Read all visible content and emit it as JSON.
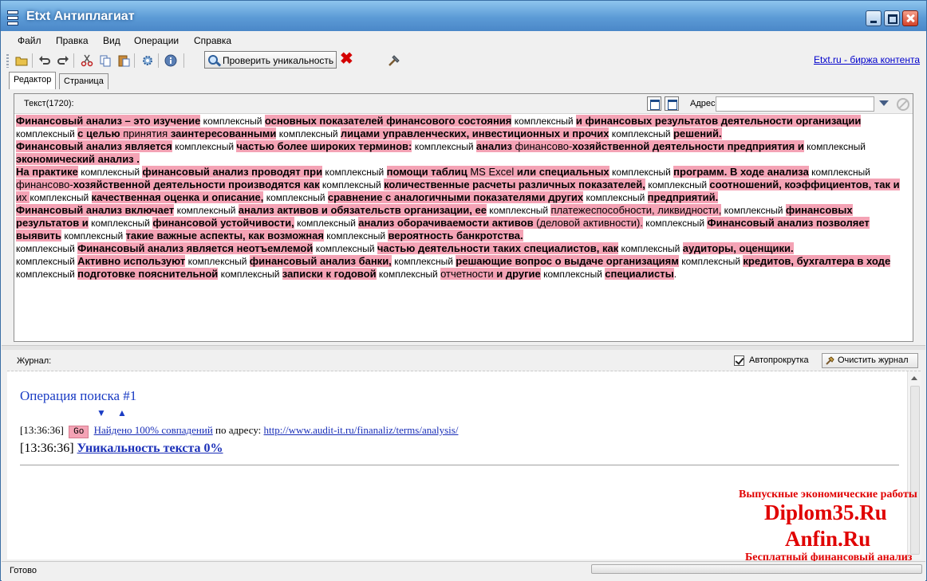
{
  "window": {
    "title": "Etxt Антиплагиат"
  },
  "menu": [
    "Файл",
    "Правка",
    "Вид",
    "Операции",
    "Справка"
  ],
  "toolbar": {
    "check_label": "Проверить уникальность",
    "top_link": "Etxt.ru - биржа контента",
    "icons": [
      "open-icon",
      "undo-icon",
      "redo-icon",
      "cut-icon",
      "copy-icon",
      "paste-icon",
      "settings-icon",
      "info-icon",
      "stop-icon",
      "tools-icon"
    ]
  },
  "tabs": [
    "Редактор",
    "Страница"
  ],
  "editor": {
    "count_label": "Текст(1720):",
    "address_label": "Адрес:",
    "address_value": ""
  },
  "journal": {
    "label": "Журнал:",
    "autoscroll_label": "Автопрокрутка",
    "autoscroll_checked": true,
    "clear_label": "Очистить журнал",
    "op_title": "Операция поиска #1",
    "arrow_down": "▼",
    "arrow_up": "▲",
    "log1_time": "[13:36:36]",
    "log1_go": "Go",
    "log1_link": "Найдено 100% совпадений",
    "log1_mid": " по адресу: ",
    "log1_url": "http://www.audit-it.ru/finanaliz/terms/analysis/",
    "log2_time": "[13:36:36]",
    "log2_link": "Уникальность текста 0%"
  },
  "watermark": {
    "line1": "Выпускные экономические работы",
    "line2": "Diplom35.Ru",
    "line3": "Anfin.Ru",
    "line4": "Бесплатный финансовый анализ"
  },
  "status": {
    "text": "Готово"
  },
  "colors": {
    "highlight": "#f4a3b5",
    "title_bar": "#5c9bd6",
    "link": "#1a2fb8",
    "watermark": "#e00000"
  }
}
